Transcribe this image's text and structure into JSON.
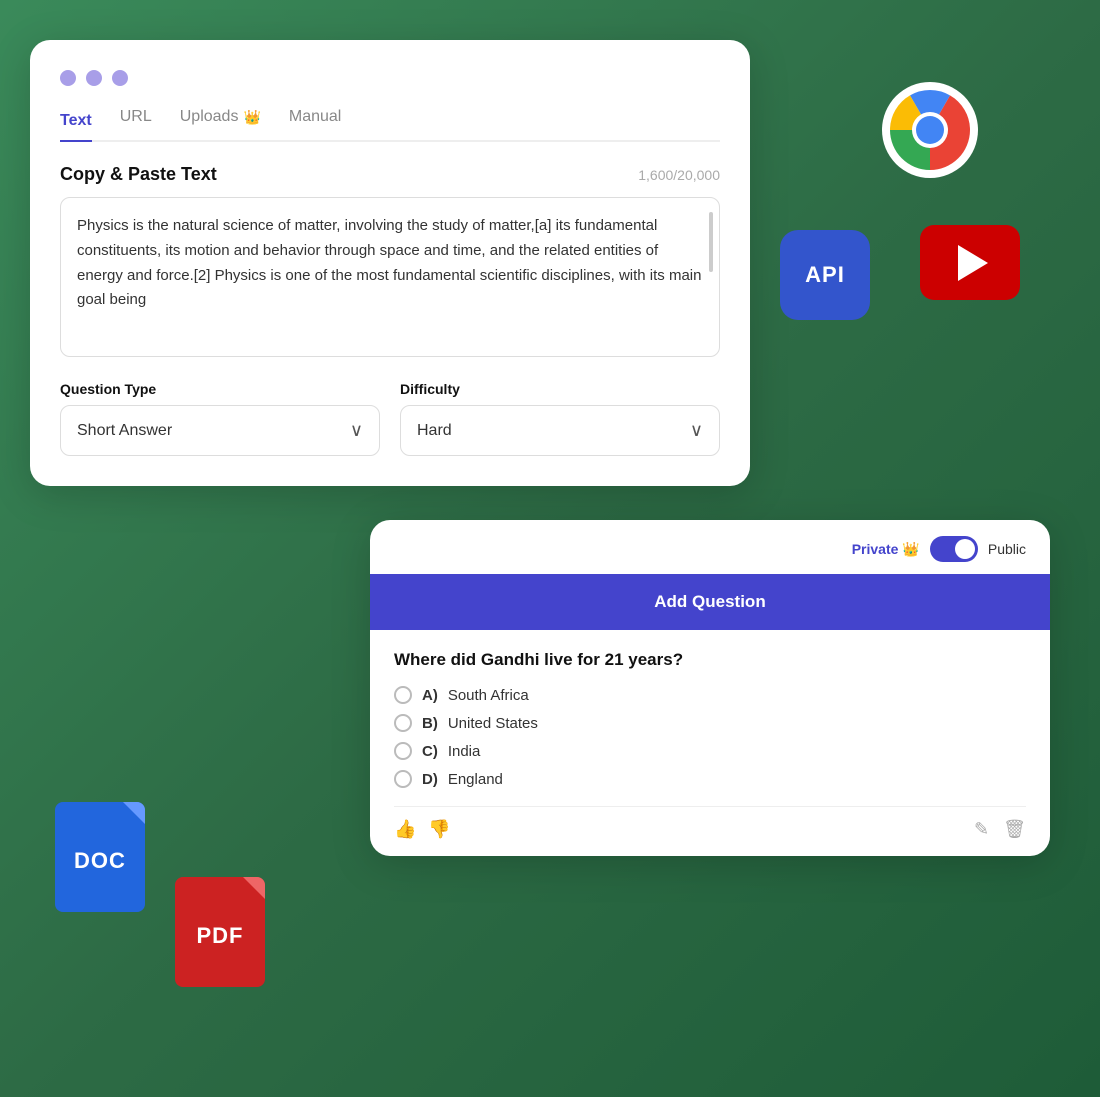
{
  "main_card": {
    "tabs": [
      {
        "label": "Text",
        "active": true,
        "crown": false
      },
      {
        "label": "URL",
        "active": false,
        "crown": false
      },
      {
        "label": "Uploads",
        "active": false,
        "crown": true
      },
      {
        "label": "Manual",
        "active": false,
        "crown": false
      }
    ],
    "section_title": "Copy & Paste Text",
    "char_count": "1,600/20,000",
    "text_content": "Physics is the natural science of matter, involving the study of matter,[a] its fundamental constituents, its motion and behavior through  space and time, and the related entities of energy and force.[2] Physics is one of the most fundamental scientific disciplines, with its main goal being",
    "question_type_label": "Question Type",
    "question_type_value": "Short Answer",
    "difficulty_label": "Difficulty",
    "difficulty_value": "Hard"
  },
  "quiz_card": {
    "private_label": "Private",
    "public_label": "Public",
    "add_question_label": "Add Question",
    "question_text": "Where did Gandhi live for 21 years?",
    "options": [
      {
        "letter": "A)",
        "text": "South Africa"
      },
      {
        "letter": "B)",
        "text": "United States"
      },
      {
        "letter": "C)",
        "text": "India"
      },
      {
        "letter": "D)",
        "text": "England"
      }
    ]
  },
  "icons": {
    "chrome": "Chrome Browser",
    "api": "API",
    "youtube": "YouTube",
    "doc": "DOC",
    "pdf": "PDF"
  }
}
